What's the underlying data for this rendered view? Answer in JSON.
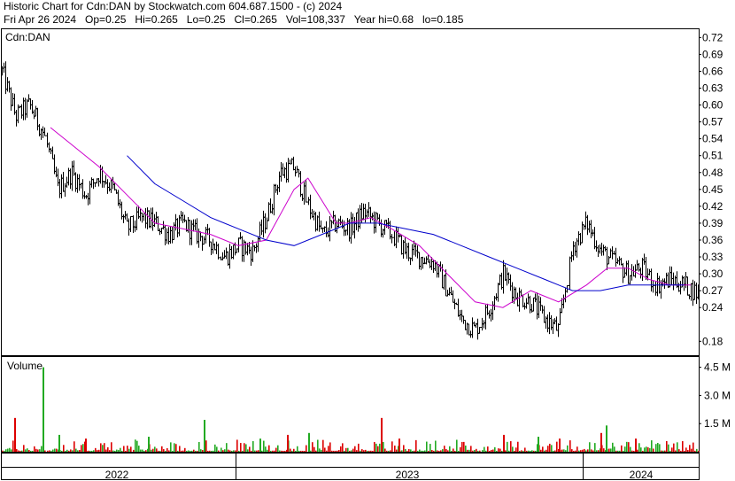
{
  "header": {
    "line1": "Historic Chart for Cdn:DAN by Stockwatch.com 604.687.1500 - (c) 2024",
    "line2": "Fri Apr 26 2024   Op=0.25   Hi=0.265   Lo=0.25   Cl=0.265   Vol=108,337   Year hi=0.68   lo=0.185"
  },
  "chart_data": [
    {
      "type": "line",
      "symbol_label": "Cdn:DAN",
      "ylim": [
        0.16,
        0.73
      ],
      "yticks": [
        "0.72",
        "0.69",
        "0.66",
        "0.63",
        "0.60",
        "0.57",
        "0.54",
        "0.51",
        "0.48",
        "0.45",
        "0.42",
        "0.39",
        "0.36",
        "0.33",
        "0.30",
        "0.27",
        "0.24",
        "0.18"
      ],
      "x_labels": [
        "2022",
        "2023",
        "2024"
      ],
      "grid": false,
      "colors": {
        "price": "#000000",
        "ma_short": "#cc00cc",
        "ma_long": "#0000cc"
      },
      "series": [
        {
          "key": "price",
          "x": [
            0,
            0.02,
            0.04,
            0.06,
            0.08,
            0.1,
            0.12,
            0.14,
            0.16,
            0.18,
            0.2,
            0.22,
            0.24,
            0.26,
            0.28,
            0.3,
            0.32,
            0.34,
            0.36,
            0.38,
            0.4,
            0.42,
            0.44,
            0.46,
            0.48,
            0.5,
            0.52,
            0.54,
            0.56,
            0.58,
            0.6,
            0.62,
            0.64,
            0.66,
            0.68,
            0.7,
            0.72,
            0.74,
            0.76,
            0.78,
            0.8,
            0.82,
            0.84,
            0.86,
            0.88,
            0.9,
            0.92,
            0.94,
            0.96,
            0.98,
            1.0
          ],
          "y": [
            0.66,
            0.58,
            0.6,
            0.55,
            0.45,
            0.48,
            0.44,
            0.48,
            0.45,
            0.38,
            0.4,
            0.39,
            0.37,
            0.39,
            0.37,
            0.36,
            0.33,
            0.35,
            0.34,
            0.4,
            0.48,
            0.49,
            0.42,
            0.37,
            0.39,
            0.38,
            0.41,
            0.39,
            0.37,
            0.34,
            0.33,
            0.32,
            0.27,
            0.22,
            0.2,
            0.24,
            0.3,
            0.26,
            0.25,
            0.22,
            0.2,
            0.35,
            0.39,
            0.34,
            0.32,
            0.3,
            0.31,
            0.28,
            0.29,
            0.28,
            0.265
          ]
        },
        {
          "key": "ma_short",
          "x": [
            0.07,
            0.1,
            0.14,
            0.18,
            0.22,
            0.26,
            0.3,
            0.34,
            0.38,
            0.42,
            0.44,
            0.46,
            0.48,
            0.5,
            0.53,
            0.56,
            0.6,
            0.64,
            0.68,
            0.72,
            0.76,
            0.8,
            0.84,
            0.87,
            0.9,
            0.93,
            0.96,
            0.99
          ],
          "y": [
            0.56,
            0.53,
            0.49,
            0.44,
            0.39,
            0.38,
            0.37,
            0.35,
            0.36,
            0.45,
            0.47,
            0.43,
            0.39,
            0.39,
            0.4,
            0.38,
            0.35,
            0.3,
            0.25,
            0.24,
            0.27,
            0.25,
            0.28,
            0.31,
            0.31,
            0.29,
            0.28,
            0.28
          ]
        },
        {
          "key": "ma_long",
          "x": [
            0.18,
            0.22,
            0.26,
            0.3,
            0.34,
            0.38,
            0.42,
            0.46,
            0.5,
            0.54,
            0.58,
            0.62,
            0.66,
            0.7,
            0.74,
            0.78,
            0.82,
            0.86,
            0.9,
            0.94,
            0.98
          ],
          "y": [
            0.51,
            0.46,
            0.43,
            0.4,
            0.38,
            0.36,
            0.35,
            0.37,
            0.39,
            0.39,
            0.38,
            0.37,
            0.35,
            0.33,
            0.31,
            0.29,
            0.27,
            0.27,
            0.28,
            0.28,
            0.28
          ]
        }
      ]
    },
    {
      "type": "bar",
      "label": "Volume",
      "ylim": [
        0,
        5000000
      ],
      "yticks": [
        "4.5 M",
        "3.0 M",
        "1.5 M"
      ],
      "colors": {
        "up": "#22aa22",
        "down": "#dd0000"
      },
      "spikes": [
        {
          "x": 0.018,
          "v": 1800000,
          "color": "down"
        },
        {
          "x": 0.058,
          "v": 4500000,
          "color": "up"
        },
        {
          "x": 0.082,
          "v": 900000,
          "color": "up"
        },
        {
          "x": 0.12,
          "v": 700000,
          "color": "down"
        },
        {
          "x": 0.21,
          "v": 800000,
          "color": "up"
        },
        {
          "x": 0.29,
          "v": 1700000,
          "color": "up"
        },
        {
          "x": 0.37,
          "v": 700000,
          "color": "up"
        },
        {
          "x": 0.41,
          "v": 900000,
          "color": "down"
        },
        {
          "x": 0.44,
          "v": 1000000,
          "color": "up"
        },
        {
          "x": 0.545,
          "v": 1800000,
          "color": "down"
        },
        {
          "x": 0.57,
          "v": 700000,
          "color": "down"
        },
        {
          "x": 0.72,
          "v": 900000,
          "color": "down"
        },
        {
          "x": 0.77,
          "v": 800000,
          "color": "up"
        },
        {
          "x": 0.8,
          "v": 700000,
          "color": "down"
        },
        {
          "x": 0.868,
          "v": 1400000,
          "color": "up"
        },
        {
          "x": 0.86,
          "v": 1000000,
          "color": "down"
        },
        {
          "x": 0.91,
          "v": 700000,
          "color": "down"
        }
      ]
    }
  ]
}
